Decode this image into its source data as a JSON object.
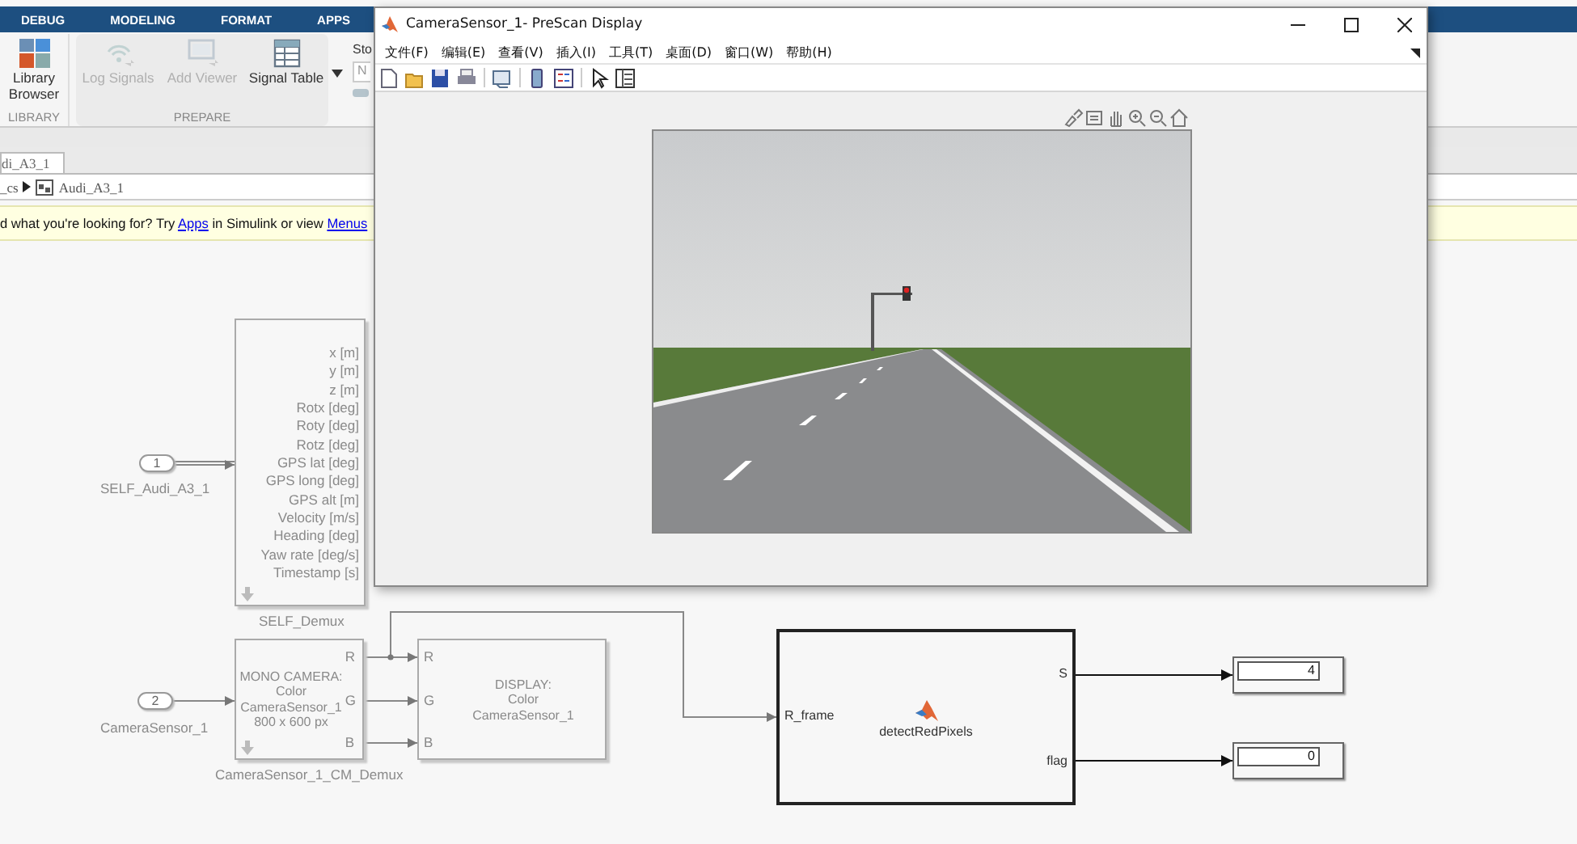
{
  "ribbon": {
    "tabs": [
      {
        "label": "DEBUG"
      },
      {
        "label": "MODELING"
      },
      {
        "label": "FORMAT"
      },
      {
        "label": "APPS"
      }
    ],
    "groups": [
      {
        "label": "LIBRARY",
        "buttons": [
          {
            "label": "Library Browser",
            "disabled": false
          }
        ]
      },
      {
        "label": "PREPARE",
        "buttons": [
          {
            "label": "Log Signals",
            "disabled": true
          },
          {
            "label": "Add Viewer",
            "disabled": true
          },
          {
            "label": "Signal Table",
            "disabled": false
          }
        ]
      }
    ],
    "next_group": {
      "label": "Sto",
      "field": "N"
    }
  },
  "model_tab": "di_A3_1",
  "breadcrumb": [
    "_cs",
    "Audi_A3_1"
  ],
  "banner": [
    {
      "kind": "text",
      "text": "d what you're looking for? Try "
    },
    {
      "kind": "link",
      "text": "Apps"
    },
    {
      "kind": "text",
      "text": " in Simulink or view "
    },
    {
      "kind": "link",
      "text": "Menus"
    }
  ],
  "diagram": {
    "inports": [
      {
        "number": "1",
        "label": "SELF_Audi_A3_1"
      },
      {
        "number": "2",
        "label": "CameraSensor_1"
      }
    ],
    "blocks": [
      {
        "kind": "demux",
        "label": "SELF_Demux",
        "outputs": [
          "x [m]",
          "y [m]",
          "z [m]",
          "Rotx [deg]",
          "Roty [deg]",
          "Rotz [deg]",
          "GPS lat [deg]",
          "GPS long [deg]",
          "GPS alt [m]",
          "Velocity [m/s]",
          "Heading [deg]",
          "Yaw rate [deg/s]",
          "Timestamp [s]"
        ]
      },
      {
        "kind": "camera",
        "label": "CameraSensor_1_CM_Demux",
        "text": "MONO CAMERA:\nColor\nCameraSensor_1\n800 x 600 px",
        "outputs": [
          "R",
          "G",
          "B"
        ]
      },
      {
        "kind": "display",
        "text": "DISPLAY:\nColor\nCameraSensor_1",
        "inputs": [
          "R",
          "G",
          "B"
        ]
      },
      {
        "kind": "function",
        "name": "detectRedPixels",
        "inputs": [
          "R_frame"
        ],
        "outputs": [
          "S",
          "flag"
        ]
      },
      {
        "kind": "numeric",
        "value": "4"
      },
      {
        "kind": "numeric",
        "value": "0"
      }
    ]
  },
  "window": {
    "title": "CameraSensor_1- PreScan Display",
    "menu": [
      "文件(F)",
      "编辑(E)",
      "查看(V)",
      "插入(I)",
      "工具(T)",
      "桌面(D)",
      "窗口(W)",
      "帮助(H)"
    ]
  }
}
